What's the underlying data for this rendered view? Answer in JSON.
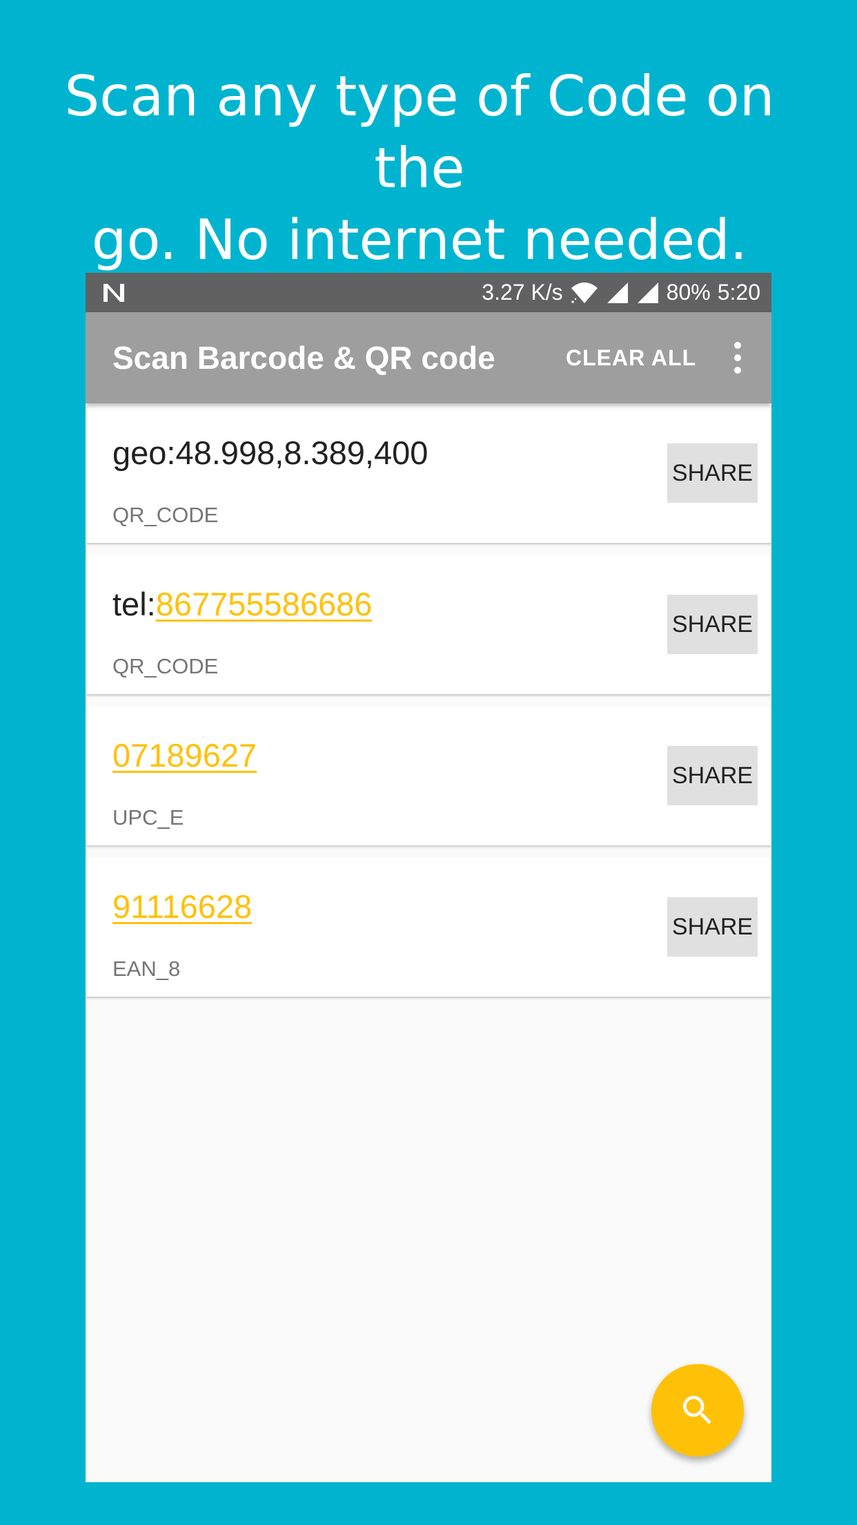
{
  "promo": {
    "headline_line1": "Scan any type of Code on the",
    "headline_line2": "go. No internet needed."
  },
  "status_bar": {
    "network_speed": "3.27 K/s",
    "battery": "80%",
    "time": "5:20",
    "icons": [
      "n-logo-icon",
      "wifi-icon",
      "signal-icon",
      "signal-icon"
    ]
  },
  "app_bar": {
    "title": "Scan Barcode & QR code",
    "clear_all": "CLEAR ALL",
    "menu_icon": "more-vert-icon"
  },
  "items": [
    {
      "prefix": "geo:48.998,8.389,400",
      "link": "",
      "type": "QR_CODE",
      "share": "SHARE"
    },
    {
      "prefix": "tel:",
      "link": "867755586686",
      "type": "QR_CODE",
      "share": "SHARE"
    },
    {
      "prefix": "",
      "link": "07189627",
      "type": "UPC_E",
      "share": "SHARE"
    },
    {
      "prefix": "",
      "link": "91116628",
      "type": "EAN_8",
      "share": "SHARE"
    }
  ],
  "fab": {
    "icon": "search-icon"
  },
  "colors": {
    "background": "#00B4D0",
    "app_bar": "#9E9E9E",
    "status_bar": "#616161",
    "accent": "#FFC107"
  }
}
